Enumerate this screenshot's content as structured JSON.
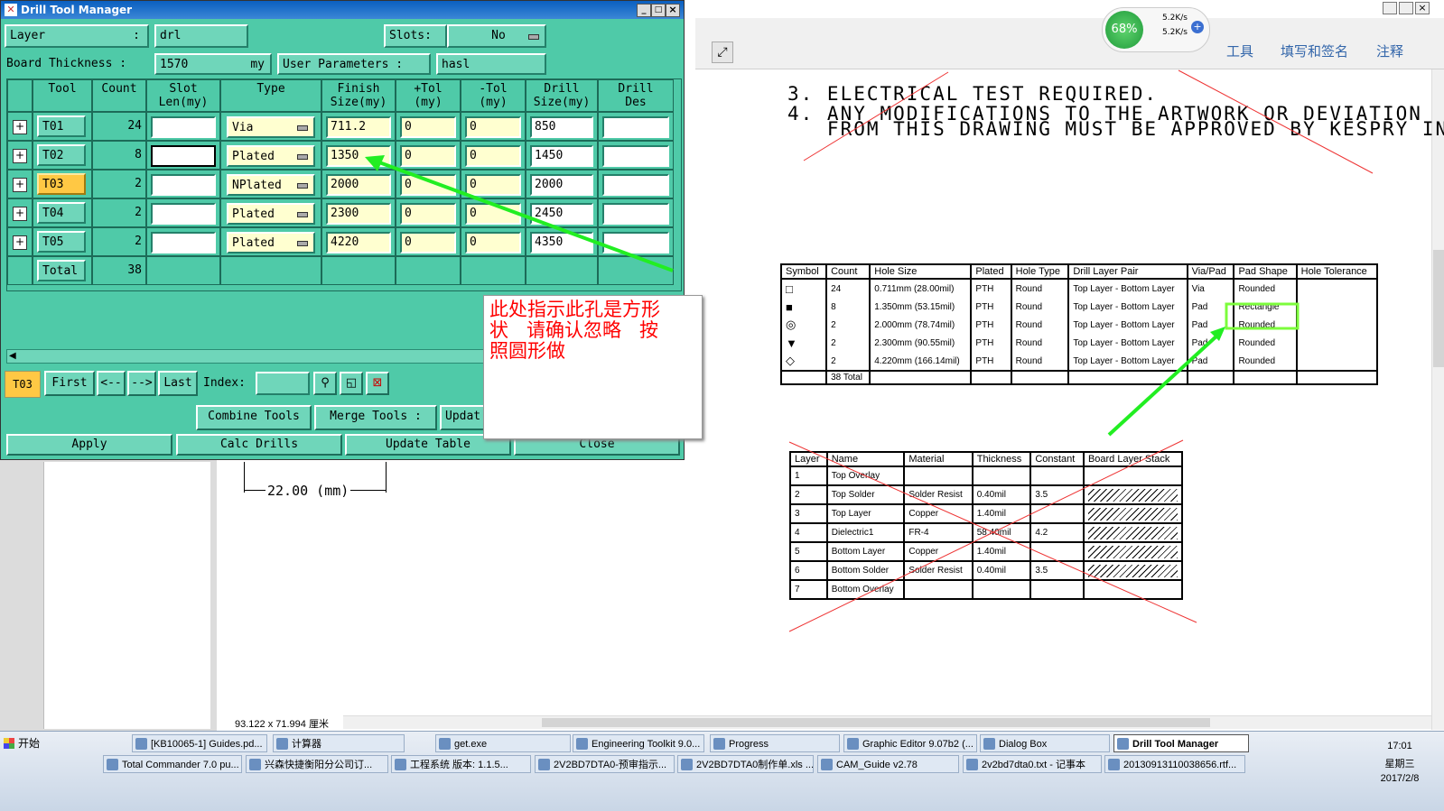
{
  "viewer": {
    "toolbar": {
      "tools": "工具",
      "fill_sign": "填写和签名",
      "comment": "注释"
    },
    "net_monitor": {
      "percent": "68%",
      "up": "5.2K/s",
      "down": "5.2K/s"
    },
    "notes": [
      "3. ELECTRICAL TEST REQUIRED.",
      "4. ANY MODIFICATIONS TO THE ARTWORK OR DEVIATION",
      "   FROM THIS DRAWING MUST BE APPROVED BY KESPRY INC."
    ],
    "dimension": "22.00 (mm)",
    "page_size": "93.122 x 71.994 厘米",
    "drill_table": {
      "headers": [
        "Symbol",
        "Count",
        "Hole Size",
        "Plated",
        "Hole Type",
        "Drill Layer Pair",
        "Via/Pad",
        "Pad Shape",
        "Hole Tolerance"
      ],
      "rows": [
        [
          "□",
          "24",
          "0.711mm (28.00mil)",
          "PTH",
          "Round",
          "Top Layer - Bottom Layer",
          "Via",
          "Rounded",
          ""
        ],
        [
          "■",
          "8",
          "1.350mm (53.15mil)",
          "PTH",
          "Round",
          "Top Layer - Bottom Layer",
          "Pad",
          "Rectangle",
          ""
        ],
        [
          "◎",
          "2",
          "2.000mm (78.74mil)",
          "PTH",
          "Round",
          "Top Layer - Bottom Layer",
          "Pad",
          "Rounded",
          ""
        ],
        [
          "▼",
          "2",
          "2.300mm (90.55mil)",
          "PTH",
          "Round",
          "Top Layer - Bottom Layer",
          "Pad",
          "Rounded",
          ""
        ],
        [
          "◇",
          "2",
          "4.220mm (166.14mil)",
          "PTH",
          "Round",
          "Top Layer - Bottom Layer",
          "Pad",
          "Rounded",
          ""
        ]
      ],
      "total": "38 Total"
    },
    "layer_table": {
      "headers": [
        "Layer",
        "Name",
        "Material",
        "Thickness",
        "Constant",
        "Board Layer Stack"
      ],
      "rows": [
        [
          "1",
          "Top Overlay",
          "",
          "",
          "",
          ""
        ],
        [
          "2",
          "Top Solder",
          "Solder Resist",
          "0.40mil",
          "3.5",
          ""
        ],
        [
          "3",
          "Top Layer",
          "Copper",
          "1.40mil",
          "",
          ""
        ],
        [
          "4",
          "Dielectric1",
          "FR-4",
          "58.40mil",
          "4.2",
          ""
        ],
        [
          "5",
          "Bottom Layer",
          "Copper",
          "1.40mil",
          "",
          ""
        ],
        [
          "6",
          "Bottom Solder",
          "Solder Resist",
          "0.40mil",
          "3.5",
          ""
        ],
        [
          "7",
          "Bottom Overlay",
          "",
          "",
          "",
          ""
        ]
      ]
    }
  },
  "dialog": {
    "title": "Drill Tool Manager",
    "layer_label": "Layer",
    "layer_value": "drl",
    "slots_label": "Slots:",
    "slots_value": "No",
    "thickness_label": "Board Thickness :",
    "thickness_value": "1570",
    "thickness_unit": "my",
    "user_params_label": "User Parameters :",
    "user_params_value": "hasl",
    "columns": [
      "Tool",
      "Count",
      "Slot\nLen(my)",
      "Type",
      "Finish\nSize(my)",
      "+Tol\n(my)",
      "-Tol\n(my)",
      "Drill\nSize(my)",
      "Drill\nDes"
    ],
    "tools": [
      {
        "tool": "T01",
        "count": "24",
        "slot": "",
        "type": "Via",
        "finish": "711.2",
        "ptol": "0",
        "ntol": "0",
        "drill": "850",
        "des": ""
      },
      {
        "tool": "T02",
        "count": "8",
        "slot": "",
        "type": "Plated",
        "finish": "1350",
        "ptol": "0",
        "ntol": "0",
        "drill": "1450",
        "des": ""
      },
      {
        "tool": "T03",
        "count": "2",
        "slot": "",
        "type": "NPlated",
        "finish": "2000",
        "ptol": "0",
        "ntol": "0",
        "drill": "2000",
        "des": ""
      },
      {
        "tool": "T04",
        "count": "2",
        "slot": "",
        "type": "Plated",
        "finish": "2300",
        "ptol": "0",
        "ntol": "0",
        "drill": "2450",
        "des": ""
      },
      {
        "tool": "T05",
        "count": "2",
        "slot": "",
        "type": "Plated",
        "finish": "4220",
        "ptol": "0",
        "ntol": "0",
        "drill": "4350",
        "des": ""
      }
    ],
    "total_label": "Total",
    "total_count": "38",
    "current_tool": "T03",
    "nav": {
      "first": "First",
      "prev": "<--",
      "next": "-->",
      "last": "Last",
      "index_label": "Index:"
    },
    "buttons": {
      "combine": "Combine Tools",
      "merge": "Merge Tools :",
      "update": "Updat",
      "apply": "Apply",
      "calc": "Calc Drills",
      "update_table": "Update Table",
      "close": "Close"
    }
  },
  "callout": {
    "text": "此处指示此孔是方形\n状   请确认忽略   按\n照圆形做"
  },
  "taskbar": {
    "start": "开始",
    "row1": [
      "[KB10065-1] Guides.pd...",
      "计算器",
      "get.exe",
      "Engineering Toolkit 9.0...",
      "Progress",
      "Graphic Editor 9.07b2 (...",
      "Dialog Box",
      "Drill Tool Manager"
    ],
    "row2": [
      "Total Commander 7.0 pu...",
      "兴森快捷衡阳分公司订...",
      "工程系统  版本: 1.1.5...",
      "2V2BD7DTA0-预审指示...",
      "2V2BD7DTA0制作单.xls ...",
      "CAM_Guide v2.78",
      "2v2bd7dta0.txt - 记事本",
      "20130913110038656.rtf..."
    ],
    "clock": {
      "time": "17:01",
      "weekday": "星期三",
      "date": "2017/2/8"
    }
  },
  "colors": {
    "dialog_bg": "#4fcaa8",
    "highlight": "#ffd24a",
    "arrow": "#22ee22",
    "annotation_text": "#ff0000"
  }
}
